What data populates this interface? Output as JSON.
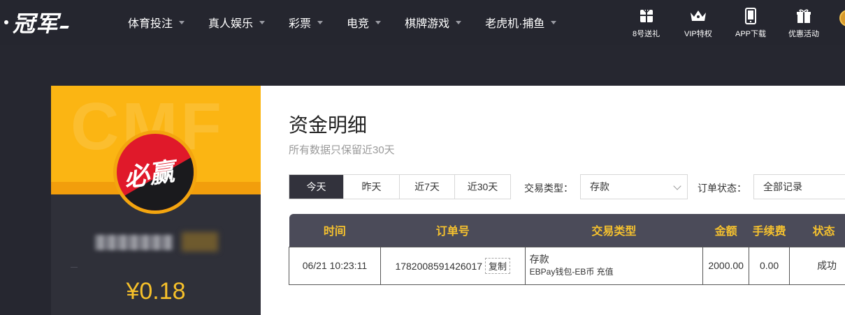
{
  "nav": {
    "logo_text": "冠军",
    "menu": [
      {
        "label": "体育投注"
      },
      {
        "label": "真人娱乐"
      },
      {
        "label": "彩票"
      },
      {
        "label": "电竞"
      },
      {
        "label": "棋牌游戏"
      },
      {
        "label": "老虎机·捕鱼"
      }
    ],
    "quick_links": {
      "gift8": "8号送礼",
      "vip": "VIP特权",
      "app": "APP下载",
      "promo": "优惠活动"
    }
  },
  "profile": {
    "avatar_text": "必赢",
    "balance": "¥0.18"
  },
  "page": {
    "title": "资金明细",
    "subtitle": "所有数据只保留近30天"
  },
  "filters": {
    "ranges": [
      "今天",
      "昨天",
      "近7天",
      "近30天"
    ],
    "active_range": "今天",
    "type_label": "交易类型：",
    "type_value": "存款",
    "status_label": "订单状态：",
    "status_value": "全部记录"
  },
  "table": {
    "headers": [
      "时间",
      "订单号",
      "交易类型",
      "金额",
      "手续费",
      "状态"
    ],
    "rows": [
      {
        "time": "06/21 10:23:11",
        "order_no": "1782008591426017",
        "copy_label": "复制",
        "type": "存款",
        "type_detail": "EBPay钱包-EB币 充值",
        "amount": "2000.00",
        "fee": "0.00",
        "status": "成功"
      }
    ]
  },
  "colors": {
    "accent_gold": "#f5c12e",
    "banner_yellow": "#fbb513",
    "dark_bg": "#262730",
    "success_green": "#2d9b2d"
  },
  "icons": [
    "gift-icon",
    "crown-icon",
    "phone-icon",
    "gift-box-icon",
    "chevron-down-icon"
  ]
}
